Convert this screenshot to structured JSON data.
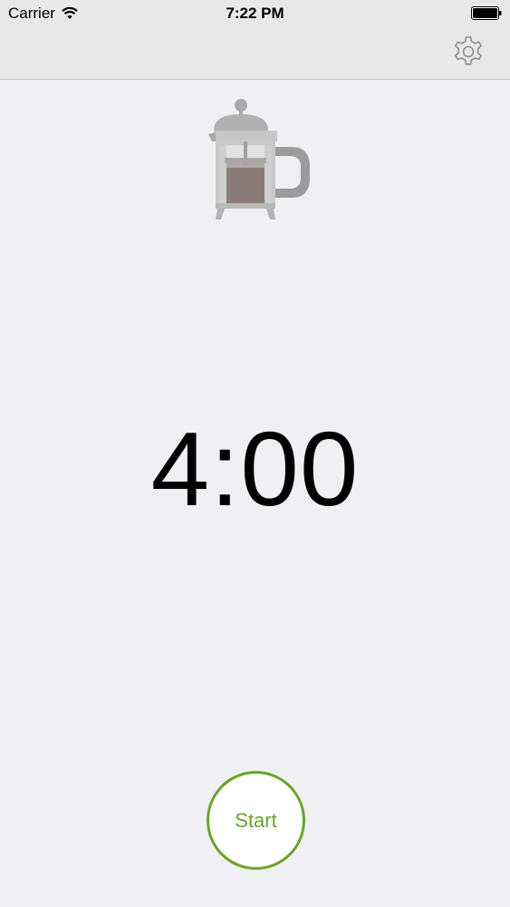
{
  "status_bar": {
    "carrier": "Carrier",
    "time": "7:22 PM",
    "wifi_icon": "wifi-icon",
    "battery_icon": "battery-icon"
  },
  "nav": {
    "settings_icon": "gear-icon"
  },
  "brew_image": {
    "icon": "french-press-icon"
  },
  "timer": {
    "value": "4:00"
  },
  "controls": {
    "start_label": "Start"
  },
  "colors": {
    "accent": "#6ba32b",
    "background": "#efeff4",
    "nav_background": "#e8e8e8",
    "press_gray": "#a3a3a3",
    "coffee": "#8b7b77"
  }
}
